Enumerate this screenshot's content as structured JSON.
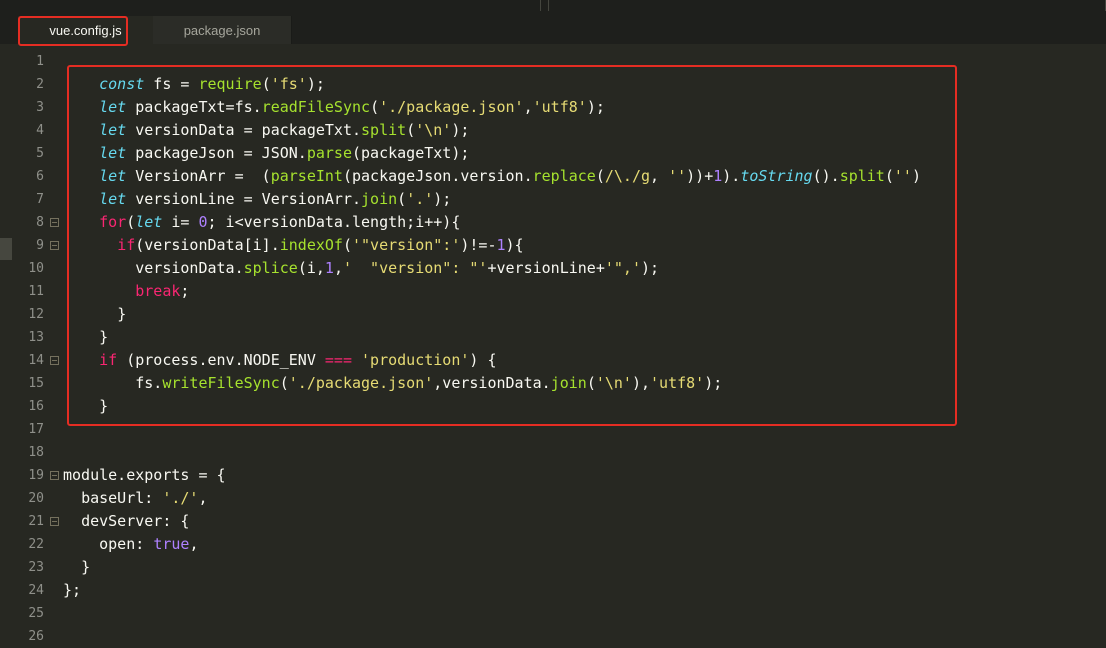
{
  "tabs": [
    {
      "label": "vue.config.js",
      "active": true
    },
    {
      "label": "package.json",
      "active": false
    }
  ],
  "highlight_color": "#e52d23",
  "code": {
    "lines": [
      {
        "n": "1"
      },
      {
        "n": "2",
        "i": "    ",
        "t": [
          {
            "c": "k",
            "v": "const"
          },
          {
            "v": " fs = "
          },
          {
            "c": "f",
            "v": "require"
          },
          {
            "v": "("
          },
          {
            "c": "s",
            "v": "'fs'"
          },
          {
            "v": ");"
          }
        ]
      },
      {
        "n": "3",
        "i": "    ",
        "t": [
          {
            "c": "k",
            "v": "let"
          },
          {
            "v": " packageTxt=fs."
          },
          {
            "c": "f",
            "v": "readFileSync"
          },
          {
            "v": "("
          },
          {
            "c": "s",
            "v": "'./package.json'"
          },
          {
            "v": ","
          },
          {
            "c": "s",
            "v": "'utf8'"
          },
          {
            "v": ");"
          }
        ]
      },
      {
        "n": "4",
        "i": "    ",
        "t": [
          {
            "c": "k",
            "v": "let"
          },
          {
            "v": " versionData = packageTxt."
          },
          {
            "c": "f",
            "v": "split"
          },
          {
            "v": "("
          },
          {
            "c": "s",
            "v": "'\\n'"
          },
          {
            "v": ");"
          }
        ]
      },
      {
        "n": "5",
        "i": "    ",
        "t": [
          {
            "c": "k",
            "v": "let"
          },
          {
            "v": " packageJson = JSON."
          },
          {
            "c": "f",
            "v": "parse"
          },
          {
            "v": "(packageTxt);"
          }
        ]
      },
      {
        "n": "6",
        "i": "    ",
        "t": [
          {
            "c": "k",
            "v": "let"
          },
          {
            "v": " VersionArr =  ("
          },
          {
            "c": "f",
            "v": "parseInt"
          },
          {
            "v": "(packageJson.version."
          },
          {
            "c": "f",
            "v": "replace"
          },
          {
            "v": "("
          },
          {
            "c": "s",
            "v": "/\\./g"
          },
          {
            "v": ", "
          },
          {
            "c": "s",
            "v": "''"
          },
          {
            "v": "))+"
          },
          {
            "c": "n",
            "v": "1"
          },
          {
            "v": ")."
          },
          {
            "c": "fi",
            "v": "toString"
          },
          {
            "v": "()."
          },
          {
            "c": "f",
            "v": "split"
          },
          {
            "v": "("
          },
          {
            "c": "s",
            "v": "''"
          },
          {
            "v": ")"
          }
        ]
      },
      {
        "n": "7",
        "i": "    ",
        "t": [
          {
            "c": "k",
            "v": "let"
          },
          {
            "v": " versionLine = VersionArr."
          },
          {
            "c": "f",
            "v": "join"
          },
          {
            "v": "("
          },
          {
            "c": "s",
            "v": "'.'"
          },
          {
            "v": ");"
          }
        ]
      },
      {
        "n": "8",
        "fold": true,
        "i": "    ",
        "t": [
          {
            "c": "kw",
            "v": "for"
          },
          {
            "v": "("
          },
          {
            "c": "k",
            "v": "let"
          },
          {
            "v": " i= "
          },
          {
            "c": "n",
            "v": "0"
          },
          {
            "v": "; i<versionData.length;i++){"
          }
        ]
      },
      {
        "n": "9",
        "fold": true,
        "i": "      ",
        "t": [
          {
            "c": "kw",
            "v": "if"
          },
          {
            "v": "(versionData[i]."
          },
          {
            "c": "f",
            "v": "indexOf"
          },
          {
            "v": "("
          },
          {
            "c": "s",
            "v": "'\"version\":'"
          },
          {
            "v": ")!=-"
          },
          {
            "c": "n",
            "v": "1"
          },
          {
            "v": "){"
          }
        ]
      },
      {
        "n": "10",
        "i": "        ",
        "t": [
          {
            "v": "versionData."
          },
          {
            "c": "f",
            "v": "splice"
          },
          {
            "v": "(i,"
          },
          {
            "c": "n",
            "v": "1"
          },
          {
            "v": ","
          },
          {
            "c": "s",
            "v": "'  \"version\": \"'"
          },
          {
            "v": "+versionLine+"
          },
          {
            "c": "s",
            "v": "'\",'"
          },
          {
            "v": ");"
          }
        ]
      },
      {
        "n": "11",
        "i": "        ",
        "t": [
          {
            "c": "kw",
            "v": "break"
          },
          {
            "v": ";"
          }
        ]
      },
      {
        "n": "12",
        "i": "      ",
        "t": [
          {
            "v": "}"
          }
        ]
      },
      {
        "n": "13",
        "i": "    ",
        "t": [
          {
            "v": "}"
          }
        ]
      },
      {
        "n": "14",
        "fold": true,
        "i": "    ",
        "t": [
          {
            "c": "kw",
            "v": "if"
          },
          {
            "v": " (process.env.NODE_ENV "
          },
          {
            "c": "kw",
            "v": "==="
          },
          {
            "v": " "
          },
          {
            "c": "s",
            "v": "'production'"
          },
          {
            "v": ") {"
          }
        ]
      },
      {
        "n": "15",
        "i": "        ",
        "t": [
          {
            "v": "fs."
          },
          {
            "c": "f",
            "v": "writeFileSync"
          },
          {
            "v": "("
          },
          {
            "c": "s",
            "v": "'./package.json'"
          },
          {
            "v": ",versionData."
          },
          {
            "c": "f",
            "v": "join"
          },
          {
            "v": "("
          },
          {
            "c": "s",
            "v": "'\\n'"
          },
          {
            "v": "),"
          },
          {
            "c": "s",
            "v": "'utf8'"
          },
          {
            "v": ");"
          }
        ]
      },
      {
        "n": "16",
        "i": "    ",
        "t": [
          {
            "v": "}"
          }
        ]
      },
      {
        "n": "17"
      },
      {
        "n": "18"
      },
      {
        "n": "19",
        "fold": true,
        "i": "",
        "t": [
          {
            "v": "module.exports = {"
          }
        ]
      },
      {
        "n": "20",
        "i": "  ",
        "t": [
          {
            "v": "baseUrl: "
          },
          {
            "c": "s",
            "v": "'./'"
          },
          {
            "v": ","
          }
        ]
      },
      {
        "n": "21",
        "fold": true,
        "i": "  ",
        "t": [
          {
            "v": "devServer: {"
          }
        ]
      },
      {
        "n": "22",
        "i": "    ",
        "t": [
          {
            "v": "open: "
          },
          {
            "c": "n",
            "v": "true"
          },
          {
            "v": ","
          }
        ]
      },
      {
        "n": "23",
        "i": "  ",
        "t": [
          {
            "v": "}"
          }
        ]
      },
      {
        "n": "24",
        "i": "",
        "t": [
          {
            "v": "};"
          }
        ]
      },
      {
        "n": "25"
      },
      {
        "n": "26"
      }
    ]
  }
}
